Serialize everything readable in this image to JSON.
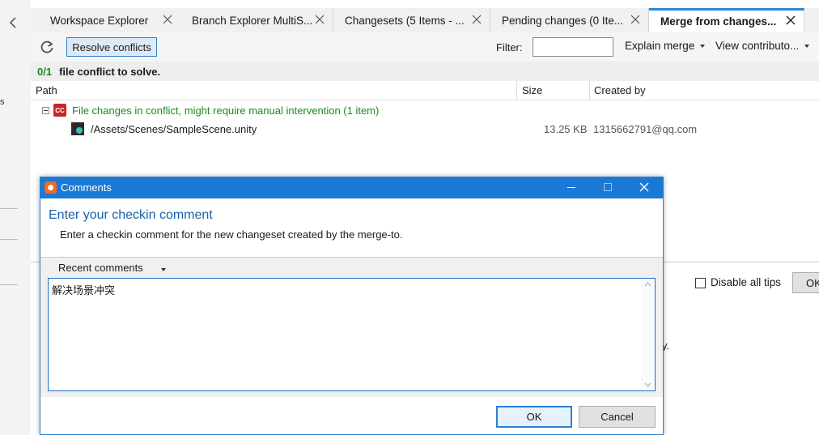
{
  "tabs": [
    {
      "label": "Workspace Explorer"
    },
    {
      "label": "Branch Explorer MultiS..."
    },
    {
      "label": "Changesets (5 Items - ..."
    },
    {
      "label": "Pending changes (0 Ite..."
    },
    {
      "label": "Merge from changes..."
    }
  ],
  "left_panel": {
    "fragment": "s"
  },
  "toolbar": {
    "resolve_label": "Resolve conflicts",
    "filter_label": "Filter:",
    "filter_value": "",
    "explain_label": "Explain merge",
    "view_label": "View contributo..."
  },
  "conflict_bar": {
    "count": "0/1",
    "text": "file conflict to solve."
  },
  "columns": {
    "path": "Path",
    "size": "Size",
    "created_by": "Created by"
  },
  "tree": {
    "group_label": "File changes in conflict, might require manual intervention (1 item)",
    "group_icon_text": "CC",
    "files": [
      {
        "path": "/Assets/Scenes/SampleScene.unity",
        "size": "13.25 KB",
        "created_by": "1315662791@qq.com"
      }
    ]
  },
  "background": {
    "disable_tips_label": "Disable all tips",
    "ok_fragment": "OK",
    "fragment": "y."
  },
  "dialog": {
    "title": "Comments",
    "heading": "Enter your checkin comment",
    "description": "Enter a checkin comment for the new changeset created by the merge-to.",
    "recent_label": "Recent comments",
    "comment": "解决场景冲突",
    "ok_label": "OK",
    "cancel_label": "Cancel"
  },
  "colors": {
    "accent": "#1a79d6",
    "conflict_green": "#1b8a1b",
    "cc_red": "#c62828"
  }
}
